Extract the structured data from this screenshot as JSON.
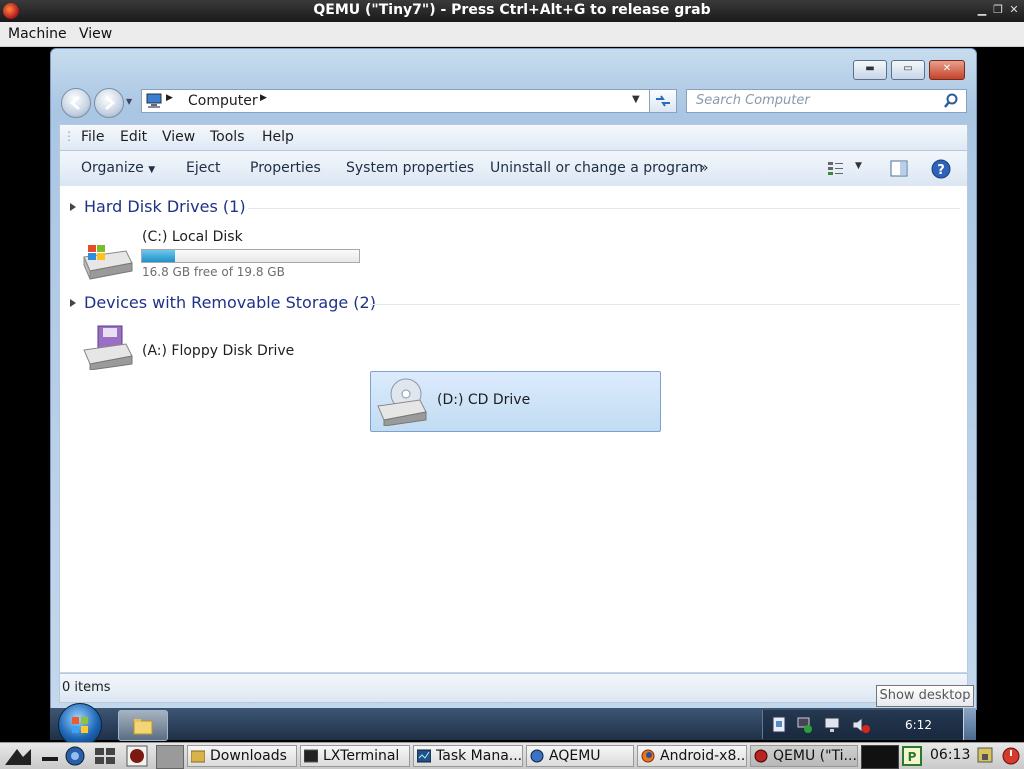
{
  "host": {
    "title": "QEMU (\"Tiny7\") - Press Ctrl+Alt+G to release grab",
    "menu": [
      "Machine",
      "View"
    ]
  },
  "explorer": {
    "address_text": "Computer",
    "search_placeholder": "Search Computer",
    "menu": [
      "File",
      "Edit",
      "View",
      "Tools",
      "Help"
    ],
    "commands": [
      "Organize",
      "Eject",
      "Properties",
      "System properties",
      "Uninstall or change a program",
      "»"
    ],
    "groups": [
      {
        "title": "Hard Disk Drives (1)",
        "items": [
          {
            "label": "(C:) Local Disk",
            "free_text": "16.8 GB free of 19.8 GB",
            "usage_fraction": 0.15
          }
        ]
      },
      {
        "title": "Devices with Removable Storage (2)",
        "items": [
          {
            "label": "(A:) Floppy Disk Drive"
          },
          {
            "label": "(D:) CD Drive"
          }
        ]
      }
    ],
    "status": "0 items",
    "tooltip": "Show desktop"
  },
  "guest_taskbar": {
    "clock": "6:12"
  },
  "host_taskbar": {
    "items": [
      "Downloads",
      "LXTerminal",
      "Task Mana...",
      "AQEMU",
      "Android-x8...",
      "QEMU (\"Ti..."
    ],
    "clock": "06:13"
  },
  "colors": {
    "selection": "#cde4f7",
    "disk_bar": "#26a0da",
    "header_text": "#1e3287"
  }
}
